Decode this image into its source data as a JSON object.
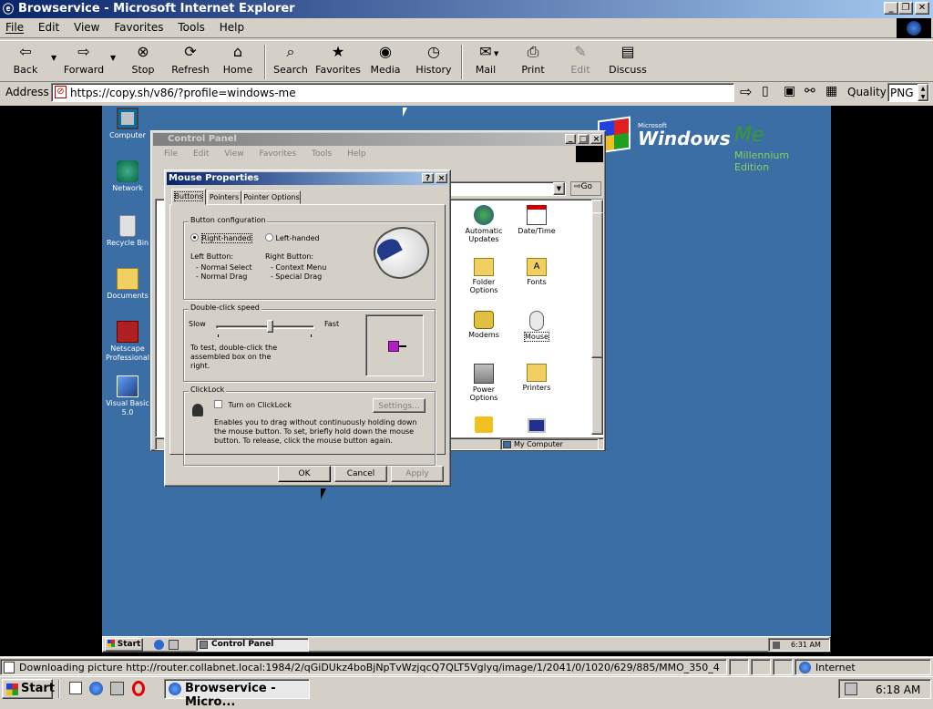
{
  "window": {
    "title": "Browservice - Microsoft Internet Explorer",
    "min": "_",
    "max": "❐",
    "close": "✕"
  },
  "menu": [
    "File",
    "Edit",
    "View",
    "Favorites",
    "Tools",
    "Help"
  ],
  "toolbar": {
    "back": "Back",
    "forward": "Forward",
    "stop": "Stop",
    "refresh": "Refresh",
    "home": "Home",
    "search": "Search",
    "favorites": "Favorites",
    "media": "Media",
    "history": "History",
    "mail": "Mail",
    "print": "Print",
    "edit": "Edit",
    "discuss": "Discuss"
  },
  "address": {
    "label": "Address",
    "url": "https://copy.sh/v86/?profile=windows-me",
    "quality_label": "Quality",
    "quality_value": "PNG"
  },
  "desktop": {
    "icons": [
      {
        "label": "Computer",
        "icon": "computer-icon"
      },
      {
        "label": "Network",
        "icon": "network-icon"
      },
      {
        "label": "Recycle Bin",
        "icon": "recycle-bin-icon"
      },
      {
        "label": "Documents",
        "icon": "documents-icon"
      },
      {
        "label": "Netscape Professional",
        "icon": "netscape-icon"
      },
      {
        "label": "Visual Basic 5.0",
        "icon": "visual-basic-icon"
      }
    ],
    "logo": {
      "microsoft": "Microsoft",
      "windows": "Windows",
      "me": "Me",
      "edition": "Millennium Edition"
    },
    "background": "#3a6ea5"
  },
  "control_panel": {
    "title": "Control Panel",
    "menu": [
      "File",
      "Edit",
      "View",
      "Favorites",
      "Tools",
      "Help"
    ],
    "go": "Go",
    "items": [
      {
        "label": "Automatic Updates"
      },
      {
        "label": "Date/Time"
      },
      {
        "label": "Folder Options"
      },
      {
        "label": "Fonts"
      },
      {
        "label": "Modems"
      },
      {
        "label": "Mouse"
      },
      {
        "label": "Power Options"
      },
      {
        "label": "Printers"
      }
    ],
    "status_right": "My Computer"
  },
  "mouse_dialog": {
    "title": "Mouse Properties",
    "tabs": [
      "Buttons",
      "Pointers",
      "Pointer Options"
    ],
    "button_config": {
      "legend": "Button configuration",
      "right_handed": "Right-handed",
      "left_handed": "Left-handed",
      "left_button": "Left Button:",
      "left_items": [
        "- Normal Select",
        "- Normal Drag"
      ],
      "right_button": "Right Button:",
      "right_items": [
        "- Context Menu",
        "- Special Drag"
      ]
    },
    "double_click": {
      "legend": "Double-click speed",
      "slow": "Slow",
      "fast": "Fast",
      "test_text": "To test, double-click the assembled box on the right.",
      "level": 0.55
    },
    "clicklock": {
      "legend": "ClickLock",
      "checkbox": "Turn on ClickLock",
      "settings": "Settings...",
      "desc": "Enables you to drag without continuously holding down the mouse button. To set, briefly hold down the mouse button. To release, click the mouse button again."
    },
    "ok": "OK",
    "cancel": "Cancel",
    "apply": "Apply"
  },
  "guest_taskbar": {
    "start": "Start",
    "task": "Control Panel",
    "clock": "6:31 AM"
  },
  "status": {
    "text": "Downloading picture http://router.collabnet.local:1984/2/qGiDUkz4boBjNpTvWzjqcQ7QLT5Vglyq/image/1/2041/0/1020/629/885/MMO_350_4",
    "zone": "Internet"
  },
  "host_taskbar": {
    "start": "Start",
    "task": "Browservice - Micro...",
    "clock": "6:18 AM"
  }
}
